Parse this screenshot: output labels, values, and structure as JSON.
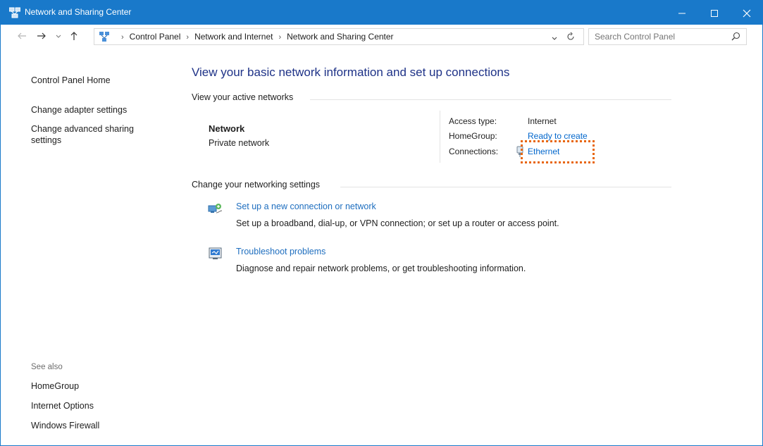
{
  "window": {
    "title": "Network and Sharing Center",
    "accent": "#1979ca"
  },
  "address": {
    "crumbs": [
      "Control Panel",
      "Network and Internet",
      "Network and Sharing Center"
    ],
    "search_placeholder": "Search Control Panel"
  },
  "left": {
    "home": "Control Panel Home",
    "adapter": "Change adapter settings",
    "advanced": "Change advanced sharing settings",
    "see_also": "See also",
    "see_also_items": [
      "HomeGroup",
      "Internet Options",
      "Windows Firewall"
    ]
  },
  "main": {
    "title": "View your basic network information and set up connections",
    "active_header": "View your active networks",
    "network": {
      "name": "Network",
      "type": "Private network",
      "access_label": "Access type:",
      "access_value": "Internet",
      "homegroup_label": "HomeGroup:",
      "homegroup_value": "Ready to create",
      "connections_label": "Connections:",
      "connections_value": "Ethernet"
    },
    "change_header": "Change your networking settings",
    "tasks": [
      {
        "link": "Set up a new connection or network",
        "desc": "Set up a broadband, dial-up, or VPN connection; or set up a router or access point.",
        "icon": "network-setup-icon"
      },
      {
        "link": "Troubleshoot problems",
        "desc": "Diagnose and repair network problems, or get troubleshooting information.",
        "icon": "troubleshoot-icon"
      }
    ]
  },
  "colors": {
    "link": "#0066cc",
    "title": "#1e3287",
    "highlight": "#e8660c"
  }
}
